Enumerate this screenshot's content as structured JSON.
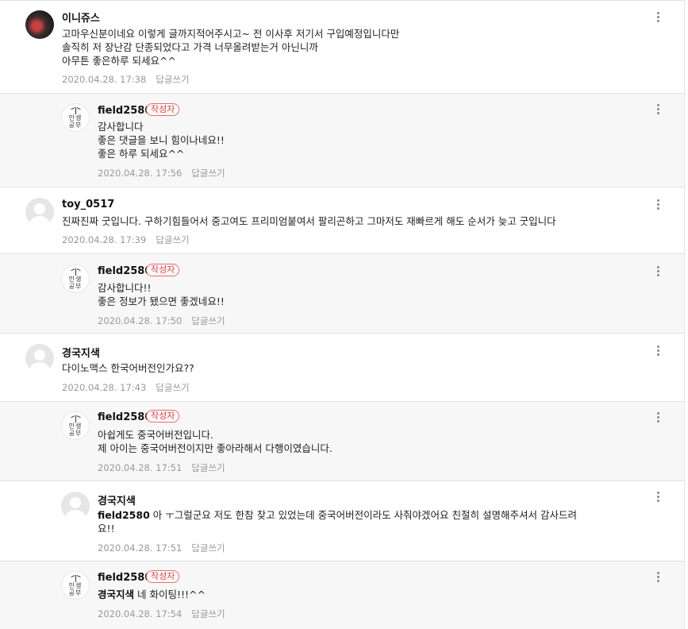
{
  "comments": [
    {
      "author": "이니쥬스",
      "lines": [
        "고마우신분이네요 이렇게 글까지적어주시고~ 전 이사후 저기서 구입예정입니다만",
        "솔직히 저 장난감 단종되었다고 가격 너무올려받는거 아닌니까",
        "아무튼 좋은하루 되세요^^"
      ],
      "date": "2020.04.28. 17:38",
      "reply_label": "답글쓰기"
    },
    {
      "author": "field2580",
      "badge": "작성자",
      "lines": [
        "감사합니다",
        "좋은 댓글을 보니 힘이나네요!!",
        "좋은 하루 되세요^^"
      ],
      "date": "2020.04.28. 17:56",
      "reply_label": "답글쓰기"
    },
    {
      "author": "toy_0517",
      "lines": [
        "진짜진짜 굿입니다. 구하기힘들어서 중고여도 프리미엄붙여서 팔리곤하고 그마저도 재빠르게 해도 순서가 늦고 굿입니다"
      ],
      "date": "2020.04.28. 17:39",
      "reply_label": "답글쓰기"
    },
    {
      "author": "field2580",
      "badge": "작성자",
      "lines": [
        "감사합니다!!",
        "좋은 정보가 됐으면 좋겠네요!!"
      ],
      "date": "2020.04.28. 17:50",
      "reply_label": "답글쓰기"
    },
    {
      "author": "경국지색",
      "lines": [
        "다이노맥스 한국어버전인가요??"
      ],
      "date": "2020.04.28. 17:43",
      "reply_label": "답글쓰기"
    },
    {
      "author": "field2580",
      "badge": "작성자",
      "lines": [
        "아쉽게도 중국어버전입니다.",
        "제 아이는 중국어버전이지만 좋아라해서 다행이였습니다."
      ],
      "date": "2020.04.28. 17:51",
      "reply_label": "답글쓰기"
    },
    {
      "author": "경국지색",
      "mention": "field2580",
      "lines": [
        " 아 ㅜ그럴군요 저도 한참 찾고 있었는데 중국어버전이라도 사줘야겠어요 친절히 설명해주셔서 감사드려",
        "요!!"
      ],
      "date": "2020.04.28. 17:51",
      "reply_label": "답글쓰기"
    },
    {
      "author": "field2580",
      "badge": "작성자",
      "mention": "경국지색",
      "lines": [
        " 네 화이팅!!!^^"
      ],
      "date": "2020.04.28. 17:54",
      "reply_label": "답글쓰기"
    }
  ],
  "logo_text": [
    "인생",
    "공부"
  ],
  "icons": {
    "more": "more-vertical-icon"
  },
  "colors": {
    "badge": "#e03a3a",
    "reply_bg": "#f7f7f7",
    "meta": "#999999"
  }
}
